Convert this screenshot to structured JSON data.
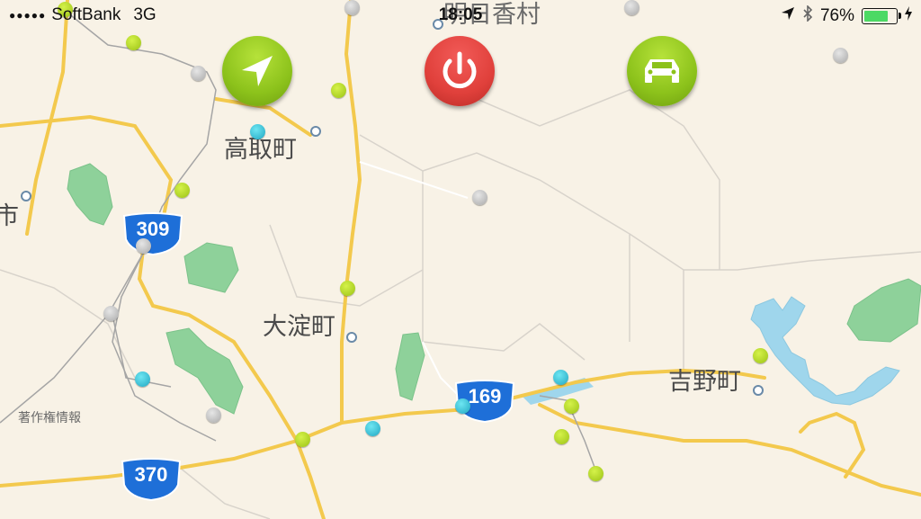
{
  "status_bar": {
    "carrier": "SoftBank",
    "network": "3G",
    "time": "18:05",
    "battery": "76%",
    "battery_level": 0.76
  },
  "buttons": {
    "locate_icon": "location-arrow-icon",
    "power_icon": "power-icon",
    "car_icon": "car-icon"
  },
  "map": {
    "labels": {
      "asuka": "明日香村",
      "takatori": "高取町",
      "oyodo": "大淀町",
      "yoshino": "吉野町",
      "shi": "市",
      "copyright": "著作権情報"
    },
    "routes": {
      "r309": "309",
      "r169": "169",
      "r370": "370"
    },
    "colors": {
      "road": "#f3c94d",
      "park": "#8ed19a",
      "water": "#9fd6ec",
      "route_shield": "#1e6fd8",
      "stop_green": "#a6cf1a",
      "stop_blue": "#2bb6cf"
    }
  }
}
